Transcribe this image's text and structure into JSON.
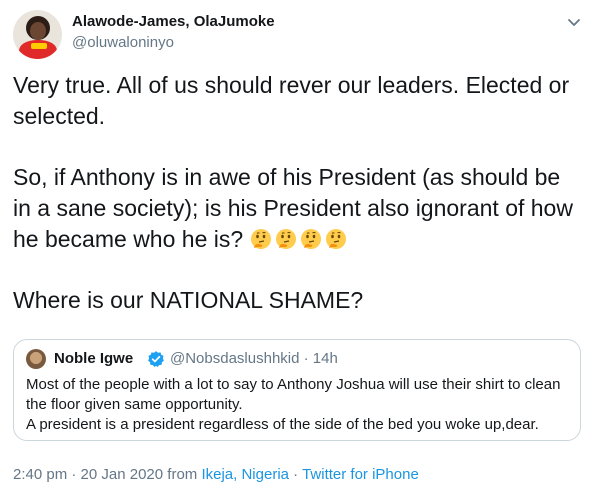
{
  "author": {
    "display_name": "Alawode-James, OlaJumoke",
    "handle": "@oluwaloninyo"
  },
  "tweet": {
    "paragraph_1": "Very true. All of us should rever our leaders. Elected or selected.",
    "paragraph_2": "So, if Anthony is in awe of his President (as should be in a sane society); is his President also ignorant of how he became who he is?",
    "paragraph_3": "Where is our NATIONAL SHAME?",
    "emoji_icon": "thinking-face-icon",
    "emoji_count": 4
  },
  "quote": {
    "display_name": "Noble Igwe",
    "verified_icon": "verified-badge-icon",
    "meta": "@Nobsdaslushhkid · 14h",
    "text_line_1": "Most of the people with a lot to say to Anthony Joshua will use their shirt to clean the floor given same opportunity.",
    "text_line_2": "A president is a president regardless of the side of the bed you woke up,dear."
  },
  "footer": {
    "timestamp": "2:40 pm · 20 Jan 2020",
    "from_label": " from ",
    "location": "Ikeja, Nigeria",
    "separator": " · ",
    "source": "Twitter for iPhone"
  },
  "colors": {
    "text": "#14171a",
    "secondary": "#657786",
    "link": "#1b95e0",
    "border": "#ccd6dd",
    "verified": "#1da1f2"
  }
}
